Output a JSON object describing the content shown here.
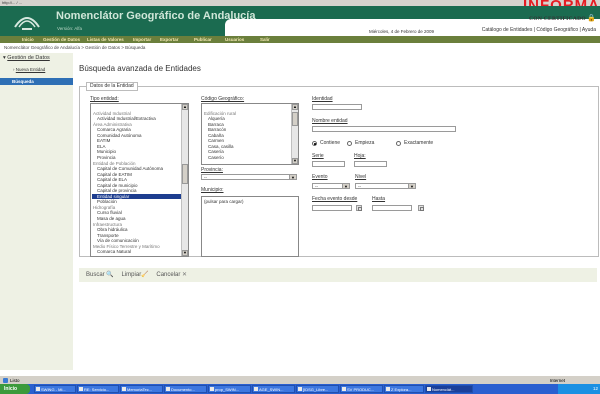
{
  "browser": {
    "address": "http://... / ...",
    "red_text": "INFORMA"
  },
  "header": {
    "title": "Nomenclátor Geográfico de Andalucía",
    "subtitle": "Versión: Alfa",
    "date": "Miércoles, 4 de Febrero de 2009",
    "certificate": "CON CERTIFICADO",
    "links": "Catálogo de Entidades  |  Código Geográfico  |  Ayuda"
  },
  "nav": {
    "items": [
      "Inicio",
      "Gestión de Datos",
      "Listas de Valores",
      "Importar",
      "Exportar",
      "Publicar",
      "Usuarios",
      "Salir"
    ]
  },
  "breadcrumb": "Nomenclátor Geográfico de Andalucía > Gestión de Datos > Búsqueda",
  "sidebar": {
    "head": "Gestión de Datos",
    "items": [
      "Nueva Entidad",
      "Búsqueda"
    ]
  },
  "page": {
    "title": "Búsqueda avanzada de Entidades",
    "legend": "Datos de la Entidad"
  },
  "form": {
    "tipo_label": "Tipo entidad:",
    "tipo_options": [
      {
        "text": "",
        "group": false
      },
      {
        "text": "Actividad Industrial",
        "group": true
      },
      {
        "text": "Actividad Industrial/Extractiva",
        "group": false
      },
      {
        "text": "Área Administrativa",
        "group": true
      },
      {
        "text": "Comarca Agraria",
        "group": false
      },
      {
        "text": "Comunidad Autónoma",
        "group": false
      },
      {
        "text": "EATIM",
        "group": false
      },
      {
        "text": "ELA",
        "group": false
      },
      {
        "text": "Municipio",
        "group": false
      },
      {
        "text": "Provincia",
        "group": false
      },
      {
        "text": "Entidad de Población",
        "group": true
      },
      {
        "text": "Capital de Comunidad Autónoma",
        "group": false
      },
      {
        "text": "Capital de EATIM",
        "group": false
      },
      {
        "text": "Capital de ELA",
        "group": false
      },
      {
        "text": "Capital de municipio",
        "group": false
      },
      {
        "text": "Capital de provincia",
        "group": false
      },
      {
        "text": "Entidad singular",
        "group": false,
        "selected": true
      },
      {
        "text": "Población",
        "group": false
      },
      {
        "text": "Hidrografía",
        "group": true
      },
      {
        "text": "Curso fluvial",
        "group": false
      },
      {
        "text": "Masa de agua",
        "group": false
      },
      {
        "text": "Infraestructura",
        "group": true
      },
      {
        "text": "Obra hidráulica",
        "group": false
      },
      {
        "text": "Transporte",
        "group": false
      },
      {
        "text": "Vía de comunicación",
        "group": false
      },
      {
        "text": "Medio Físico Terrestre y Marítimo",
        "group": true
      },
      {
        "text": "Comarca Natural",
        "group": false
      }
    ],
    "codigo_label": "Código Geográfico:",
    "codigo_options": [
      {
        "text": "",
        "group": false
      },
      {
        "text": "Edificación rural",
        "group": true
      },
      {
        "text": "Alquería",
        "group": false
      },
      {
        "text": "Barraca",
        "group": false
      },
      {
        "text": "Barracón",
        "group": false
      },
      {
        "text": "Cabaña",
        "group": false
      },
      {
        "text": "Carmen",
        "group": false
      },
      {
        "text": "Casa, casilla",
        "group": false
      },
      {
        "text": "Casería",
        "group": false
      },
      {
        "text": "Caserío",
        "group": false
      }
    ],
    "provincia_label": "Provincia:",
    "provincia_value": "--",
    "municipio_label": "Municipio:",
    "municipio_value": "(pulsar para cargar)",
    "identidad_label": "Identidad",
    "nombre_label": "Nombre entidad",
    "radio_options": [
      "Contiene",
      "Empieza",
      "Exactamente"
    ],
    "serie_label": "Serie",
    "hoja_label": "Hoja:",
    "evento_label": "Evento",
    "evento_value": "--",
    "nivel_label": "Nivel",
    "nivel_value": "--",
    "fecha_desde_label": "Fecha evento desde",
    "hasta_label": "Hasta"
  },
  "actions": {
    "buscar": "Buscar",
    "limpiar": "Limpiar",
    "cancelar": "Cancelar"
  },
  "statusbar": {
    "left": "Listo",
    "right": "Internet"
  },
  "taskbar": {
    "start": "Inicio",
    "tasks": [
      "SWING - Mi...",
      "RE: Servicio...",
      "MemoriaTec...",
      "Documento...",
      "prop_SWIN...",
      "AGE_SWIN...",
      "[IDSG_Libre...",
      "SV PRODUC...",
      "Z Explora...",
      "Nomenclát..."
    ],
    "clock": "12"
  }
}
